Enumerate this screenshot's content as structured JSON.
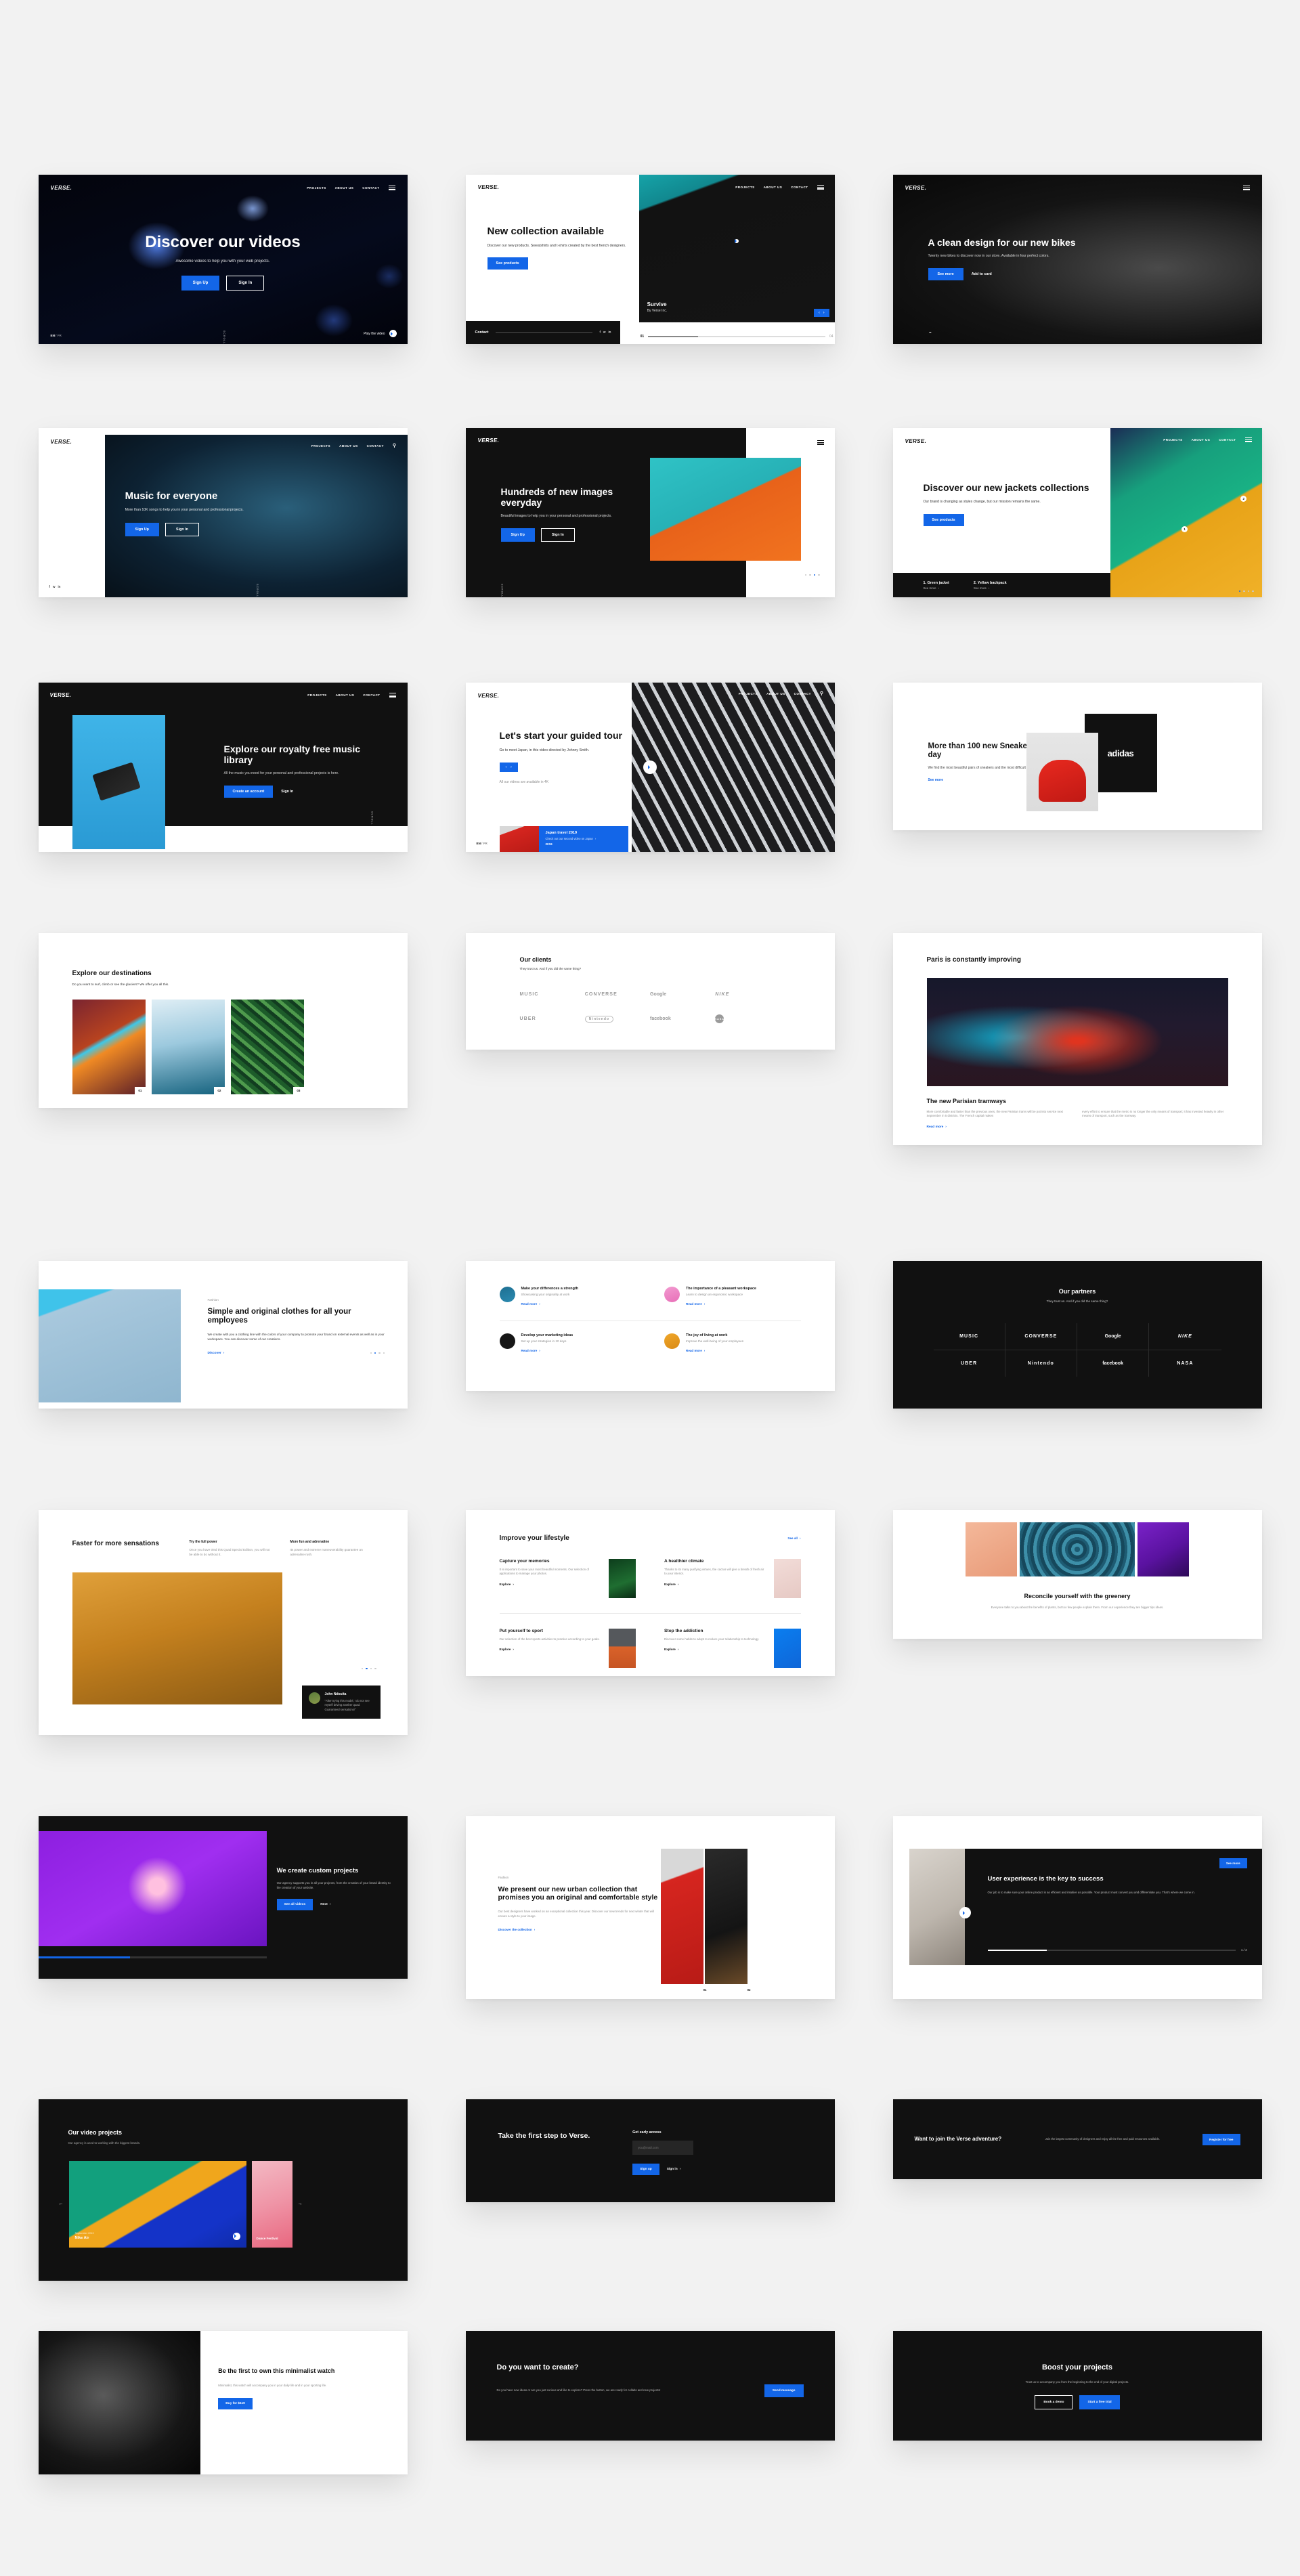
{
  "brand": {
    "logo": "VERSE.",
    "accent_color": "#1366e8",
    "dark_color": "#111111",
    "page_bg": "#f2f2f2"
  },
  "nav": {
    "projects": "PROJECTS",
    "about": "ABOUT US",
    "contact": "CONTACT",
    "menu_icon": "hamburger-icon",
    "search_icon": "search-icon"
  },
  "cards": {
    "videos": {
      "title": "Discover our videos",
      "subtitle": "Awesome videos to help you with your web projects.",
      "primary_btn": "Sign Up",
      "secondary_btn": "Sign In",
      "lang_active": "EN",
      "lang_other": "FR",
      "scroll_label": "SCROLL",
      "play_label": "Play the video"
    },
    "collection": {
      "title": "New collection available",
      "body": "Discover our new products. Sweatshirts and t-shirts created by the best french designers.",
      "btn": "See products",
      "contact_label": "Contact",
      "social": [
        "f",
        "t",
        "in"
      ],
      "slide_title": "Survive",
      "slide_sub": "By Verse Inc.",
      "index_current": "01",
      "index_total": "04"
    },
    "bikes": {
      "title": "A clean design for our new bikes",
      "body": "Twenty new bikes to discover now in our store. Available in four perfect colors.",
      "primary_btn": "See more",
      "secondary_btn": "Add to card"
    },
    "music": {
      "title": "Music for everyone",
      "body": "More than 10K songs to help you in your personal and professional projects.",
      "primary_btn": "Sign Up",
      "secondary_btn": "Sign In",
      "scroll_label": "SCROLL",
      "social": [
        "f",
        "t",
        "in"
      ]
    },
    "images": {
      "title": "Hundreds of new images everyday",
      "body": "Beautiful images to help you in your personal and professional projects.",
      "primary_btn": "Sign Up",
      "secondary_btn": "Sign In",
      "scroll_label": "SCROLL"
    },
    "jackets": {
      "title": "Discover our new jackets collections",
      "body": "Our brand is changing as styles change, but our mission remains the same.",
      "btn": "See products",
      "item1_title": "1. Green jacket",
      "item1_link": "See more",
      "item2_title": "2. Yellow backpack",
      "item2_link": "See more",
      "hotspot1": "1",
      "hotspot2": "2"
    },
    "library": {
      "title": "Explore our royalty free music library",
      "body": "All the music you need for your personal and professional projects is here.",
      "primary_btn": "Create an account",
      "secondary_btn": "Sign In",
      "scroll_label": "SCROLL"
    },
    "tour": {
      "title": "Let's start your guided tour",
      "body": "Go to meet Japan, in this video directed by Johnny Smith.",
      "note": "All our videos are available in 4K",
      "lang_active": "EN",
      "lang_other": "FR",
      "promo_title": "Japan travel 2019",
      "promo_sub": "Check out our second video on Japan",
      "promo_meta": "2019"
    },
    "sneakers": {
      "title": "More than 100 new Sneakers every day",
      "body": "We find the most beautiful pairs of sneakers and the most difficult to find on the market.",
      "link": "See more",
      "logo_text": "adidas"
    },
    "destinations": {
      "title": "Explore our destinations",
      "body": "Do you want to surf, climb or see the glaciers? We offer you all this.",
      "items": [
        {
          "index": "01",
          "name": "canyon"
        },
        {
          "index": "02",
          "name": "wave"
        },
        {
          "index": "03",
          "name": "leaves"
        }
      ]
    },
    "clients": {
      "title": "Our clients",
      "body": "They trust us. And if you did the same thing?",
      "logos": [
        "MUSIC",
        "CONVERSE",
        "Google",
        "NIKE",
        "UBER",
        "Nintendo",
        "facebook",
        "NASA"
      ]
    },
    "paris": {
      "title": "Paris is constantly improving",
      "article_title": "The new Parisian tramways",
      "col1": "More comfortable and faster than the previous ones, the new Parisian trams will be put into service next September in 5 districts. The French capital makes",
      "col2": "every effort to ensure that the metro is no longer the only means of transport; it has invested heavily in other means of transport, such as the tramway.",
      "link": "Read more"
    },
    "clothes": {
      "eyebrow": "Fashion",
      "title": "Simple and original clothes for all your employees",
      "body": "We create with you a clothing line with the colors of your company to promote your brand on external events as well as in your workspace. You can discover some of our creations.",
      "link": "Discover",
      "dots": 4,
      "active_dot": 2
    },
    "articles": {
      "items": [
        {
          "title": "Make your differences a strength",
          "sub": "Showcasing your originality at work",
          "link": "Read more",
          "avatar": "hat-avatar"
        },
        {
          "title": "The importance of a pleasant workspace",
          "sub": "Learn to design an ergonomic workspace",
          "link": "Read more",
          "avatar": "lamp-avatar"
        },
        {
          "title": "Develop your marketing ideas",
          "sub": "Set up your strategies in 10 days",
          "link": "Read more",
          "avatar": "bulb-avatar"
        },
        {
          "title": "The joy of living at work",
          "sub": "Improve the well-being of your employees",
          "link": "Read more",
          "avatar": "portrait-avatar"
        }
      ]
    },
    "partners": {
      "title": "Our partners",
      "body": "They trust us. And if you did the same thing?",
      "logos": [
        "MUSIC",
        "CONVERSE",
        "Google",
        "NIKE",
        "UBER",
        "Nintendo",
        "facebook",
        "NASA"
      ]
    },
    "sensations": {
      "title": "Faster for more sensations",
      "col1_title": "Try the full power",
      "col1_body": "Once you have tried this Quad Special Edition, you will not be able to do without it.",
      "col2_title": "More fun and adrenaline",
      "col2_body": "Its power and extreme maneuverability guarantee an adrenaline rush.",
      "quote_name": "John Ndouita",
      "quote_text": "\"After trying this model, I do not see myself driving another quad. Guaranteed sensations!\"",
      "dots": 4,
      "active_dot": 2
    },
    "lifestyle": {
      "title": "Improve your lifestyle",
      "see_all": "See all",
      "items": [
        {
          "title": "Capture your memories",
          "body": "It is important to save your most beautiful moments. Our selection of applications to manage your photos.",
          "link": "Explore",
          "thumb": "camera"
        },
        {
          "title": "A healthier climate",
          "body": "Thanks to its many purifying virtues, the cactus will give a breath of fresh air to your interior.",
          "link": "Explore",
          "thumb": "cactus"
        },
        {
          "title": "Put yourself to sport",
          "body": "Our selection of the best sports activities to practice according to your goals.",
          "link": "Explore",
          "thumb": "basketball"
        },
        {
          "title": "Stop the addiction",
          "body": "Discover some habits to adopt to reduce your relationship to technology.",
          "link": "Explore",
          "thumb": "phone"
        }
      ]
    },
    "greenery": {
      "title": "Reconcile yourself with the greenery",
      "body": "Everyone talks to you about the benefits of plants, but too few people explain them. From our experience they are bigger tips ideas."
    },
    "custom": {
      "title": "We create custom projects",
      "body": "Our agency supports you in all your projects, from the creation of your brand identity to the creation of your website.",
      "primary_btn": "See all videos",
      "secondary_btn": "Next"
    },
    "urban": {
      "eyebrow": "Fashion",
      "title": "We present our new urban collection that promises you an original and comfortable style",
      "body": "Our best designers have worked on an exceptional collection this year. Discover our new trends for next winter that will ensure a style to your image.",
      "link": "Discover the collection",
      "index1": "01",
      "index2": "02"
    },
    "ux": {
      "title": "User experience is the key to success",
      "body": "Our job is to make sure your online product is as efficient and intuitive as possible. Your product must convert you and differentiate you. That's where we come in.",
      "btn": "See more",
      "index_current": "1",
      "index_total": "4"
    },
    "videoprojects": {
      "title": "Our video projects",
      "body": "Our agency is used to working with the biggest brands.",
      "slide1_meta": "September 2019",
      "slide1_title": "Nike Air",
      "slide2_title": "Dance Festival"
    },
    "firststep": {
      "title": "Take the first step to Verse.",
      "form_label": "Get early access",
      "input_placeholder": "you@mail.com",
      "primary_btn": "Sign up",
      "secondary_btn": "Sign in"
    },
    "joinverse": {
      "title": "Want to join the Verse adventure?",
      "body": "Join the largest community of designers and enjoy all the free and paid resources available.",
      "btn": "Register for free"
    },
    "watch": {
      "title": "Be the first to own this minimalist watch",
      "body": "Minimalist, this watch will accompany you in your daily life and in your sporting life.",
      "btn": "Buy for $119"
    },
    "create": {
      "title": "Do you want to create?",
      "body": "Do you have new ideas or are you just curious and like to explore? Press the button, we are ready for collabs and new projects!",
      "btn": "Send message"
    },
    "boost": {
      "title": "Boost your projects",
      "body": "Trust us to accompany you from the beginning to the end of your digital projects.",
      "primary_btn": "Book a demo",
      "secondary_btn": "Start a free trial"
    }
  }
}
